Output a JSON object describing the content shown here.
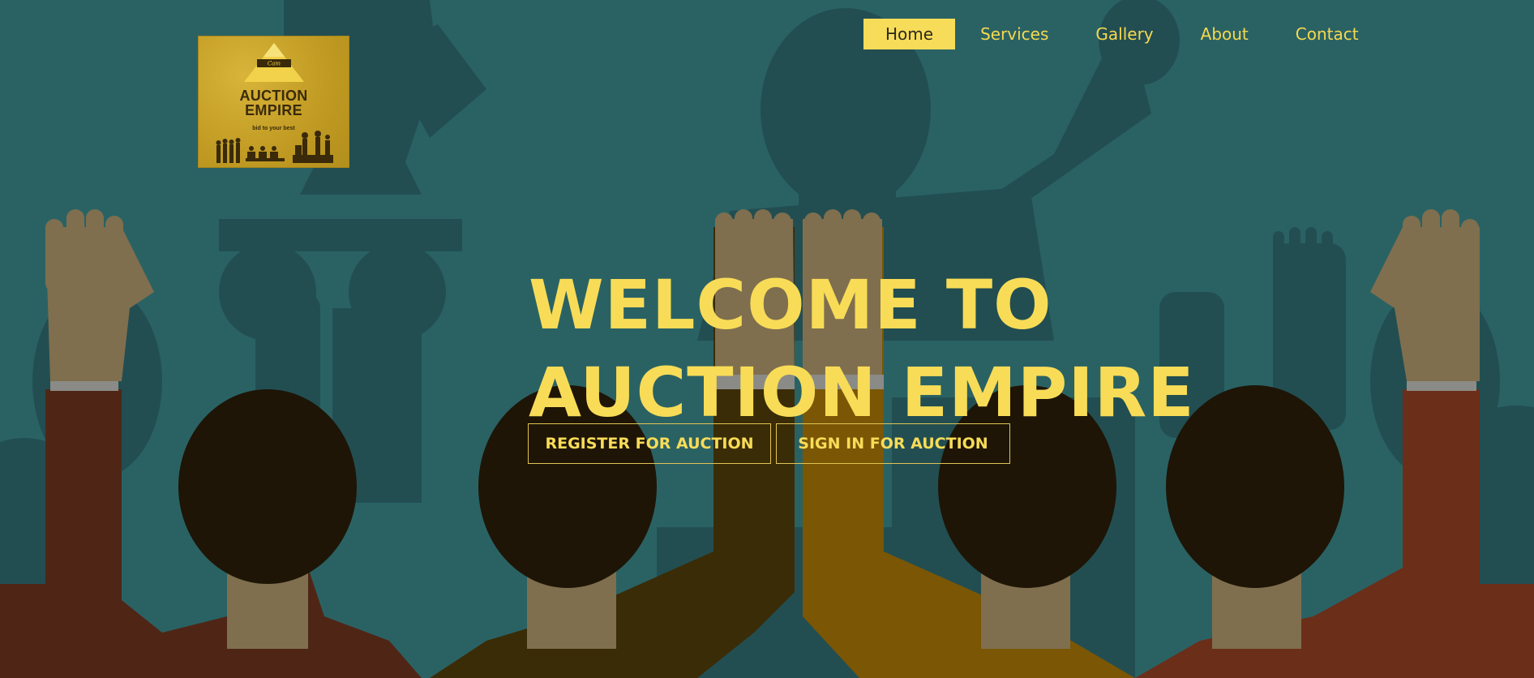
{
  "logo": {
    "script_text": "Cam",
    "title_line1": "AUCTION",
    "title_line2": "EMPIRE",
    "tagline": "bid to your best"
  },
  "nav": {
    "items": [
      {
        "label": "Home",
        "active": true
      },
      {
        "label": "Services",
        "active": false
      },
      {
        "label": "Gallery",
        "active": false
      },
      {
        "label": "About",
        "active": false
      },
      {
        "label": "Contact",
        "active": false
      }
    ]
  },
  "hero": {
    "headline_line1": "WELCOME TO",
    "headline_line2": "AUCTION EMPIRE",
    "register_label": "REGISTER FOR AUCTION",
    "signin_label": "SIGN IN FOR AUCTION"
  },
  "colors": {
    "background": "#2a6264",
    "accent": "#f8dc57",
    "logo_gold": "#c9a227"
  }
}
